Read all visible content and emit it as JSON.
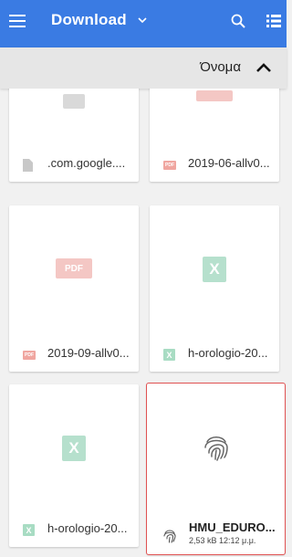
{
  "appbar": {
    "title": "Download",
    "icons": [
      "menu-icon",
      "chevron-down-icon",
      "search-icon",
      "list-view-icon"
    ]
  },
  "sort": {
    "label": "Όνομα",
    "direction_icon": "chevron-up-icon"
  },
  "files": [
    {
      "name": ".com.google....",
      "icon": "document-icon",
      "thumb": "doc"
    },
    {
      "name": "2019-06-allv0...",
      "icon": "pdf-icon",
      "thumb": "pdf"
    },
    {
      "name": "2019-09-allv0...",
      "icon": "pdf-icon",
      "thumb": "pdf",
      "thumb_label": "PDF"
    },
    {
      "name": "h-orologio-20...",
      "icon": "excel-icon",
      "thumb": "excel",
      "thumb_label": "X"
    },
    {
      "name": "h-orologio-20...",
      "icon": "excel-icon",
      "thumb": "excel",
      "thumb_label": "X"
    },
    {
      "name": "HMU_EDURO...",
      "meta": "2,53 kB 12:12 μ.μ.",
      "icon": "fingerprint-icon",
      "thumb": "fingerprint",
      "selected": true
    }
  ],
  "colors": {
    "appbar": "#3a7be3",
    "sortbar": "#e6e6e6",
    "background": "#f1f1f1",
    "selection": "#e05252",
    "pdf": "#f4c7c4",
    "excel": "#b6e0cd"
  }
}
